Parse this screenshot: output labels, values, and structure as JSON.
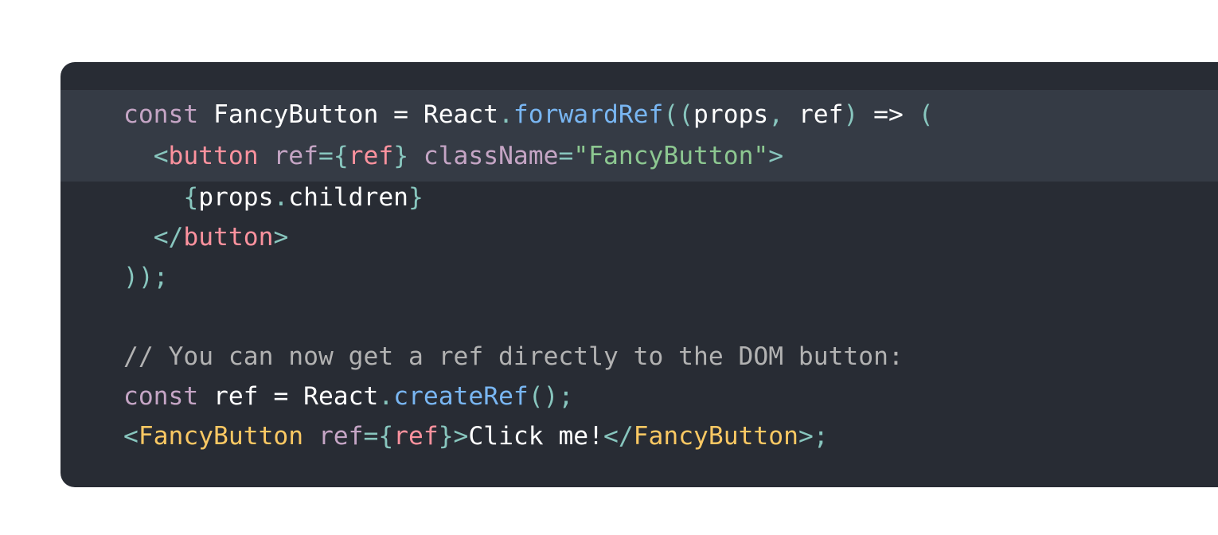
{
  "colors": {
    "page_background": "#ffffff",
    "code_background": "#282c34",
    "highlight_background": "#353b45",
    "plain": "#ffffff",
    "keyword": "#c5a5c5",
    "punctuation": "#88c6be",
    "function": "#79b6f2",
    "tag": "#fc929e",
    "attribute": "#c5a5c5",
    "string": "#8dc891",
    "comment": "#b2b2b2",
    "component": "#fac863"
  },
  "code": {
    "highlighted_lines": [
      1,
      2
    ],
    "lines": [
      [
        {
          "t": "keyword",
          "v": "const"
        },
        {
          "t": "plain",
          "v": " FancyButton "
        },
        {
          "t": "plain",
          "v": "="
        },
        {
          "t": "plain",
          "v": " React"
        },
        {
          "t": "punct",
          "v": "."
        },
        {
          "t": "func",
          "v": "forwardRef"
        },
        {
          "t": "punct",
          "v": "(("
        },
        {
          "t": "plain",
          "v": "props"
        },
        {
          "t": "punct",
          "v": ","
        },
        {
          "t": "plain",
          "v": " ref"
        },
        {
          "t": "punct",
          "v": ")"
        },
        {
          "t": "plain",
          "v": " => "
        },
        {
          "t": "punct",
          "v": "("
        }
      ],
      [
        {
          "t": "plain",
          "v": "  "
        },
        {
          "t": "punct",
          "v": "<"
        },
        {
          "t": "tag",
          "v": "button"
        },
        {
          "t": "plain",
          "v": " "
        },
        {
          "t": "attr",
          "v": "ref"
        },
        {
          "t": "punct",
          "v": "="
        },
        {
          "t": "punct",
          "v": "{"
        },
        {
          "t": "tag",
          "v": "ref"
        },
        {
          "t": "punct",
          "v": "}"
        },
        {
          "t": "plain",
          "v": " "
        },
        {
          "t": "attr",
          "v": "className"
        },
        {
          "t": "punct",
          "v": "="
        },
        {
          "t": "string",
          "v": "\"FancyButton\""
        },
        {
          "t": "punct",
          "v": ">"
        }
      ],
      [
        {
          "t": "plain",
          "v": "    "
        },
        {
          "t": "punct",
          "v": "{"
        },
        {
          "t": "plain",
          "v": "props"
        },
        {
          "t": "punct",
          "v": "."
        },
        {
          "t": "plain",
          "v": "children"
        },
        {
          "t": "punct",
          "v": "}"
        }
      ],
      [
        {
          "t": "plain",
          "v": "  "
        },
        {
          "t": "punct",
          "v": "</"
        },
        {
          "t": "tag",
          "v": "button"
        },
        {
          "t": "punct",
          "v": ">"
        }
      ],
      [
        {
          "t": "punct",
          "v": "));"
        }
      ],
      [],
      [
        {
          "t": "comment",
          "v": "// You can now get a ref directly to the DOM button:"
        }
      ],
      [
        {
          "t": "keyword",
          "v": "const"
        },
        {
          "t": "plain",
          "v": " ref "
        },
        {
          "t": "plain",
          "v": "="
        },
        {
          "t": "plain",
          "v": " React"
        },
        {
          "t": "punct",
          "v": "."
        },
        {
          "t": "func",
          "v": "createRef"
        },
        {
          "t": "punct",
          "v": "();"
        }
      ],
      [
        {
          "t": "punct",
          "v": "<"
        },
        {
          "t": "comp",
          "v": "FancyButton"
        },
        {
          "t": "plain",
          "v": " "
        },
        {
          "t": "attr",
          "v": "ref"
        },
        {
          "t": "punct",
          "v": "="
        },
        {
          "t": "punct",
          "v": "{"
        },
        {
          "t": "tag",
          "v": "ref"
        },
        {
          "t": "punct",
          "v": "}"
        },
        {
          "t": "punct",
          "v": ">"
        },
        {
          "t": "plain",
          "v": "Click me!"
        },
        {
          "t": "punct",
          "v": "</"
        },
        {
          "t": "comp",
          "v": "FancyButton"
        },
        {
          "t": "punct",
          "v": ">"
        },
        {
          "t": "punct",
          "v": ";"
        }
      ]
    ]
  }
}
